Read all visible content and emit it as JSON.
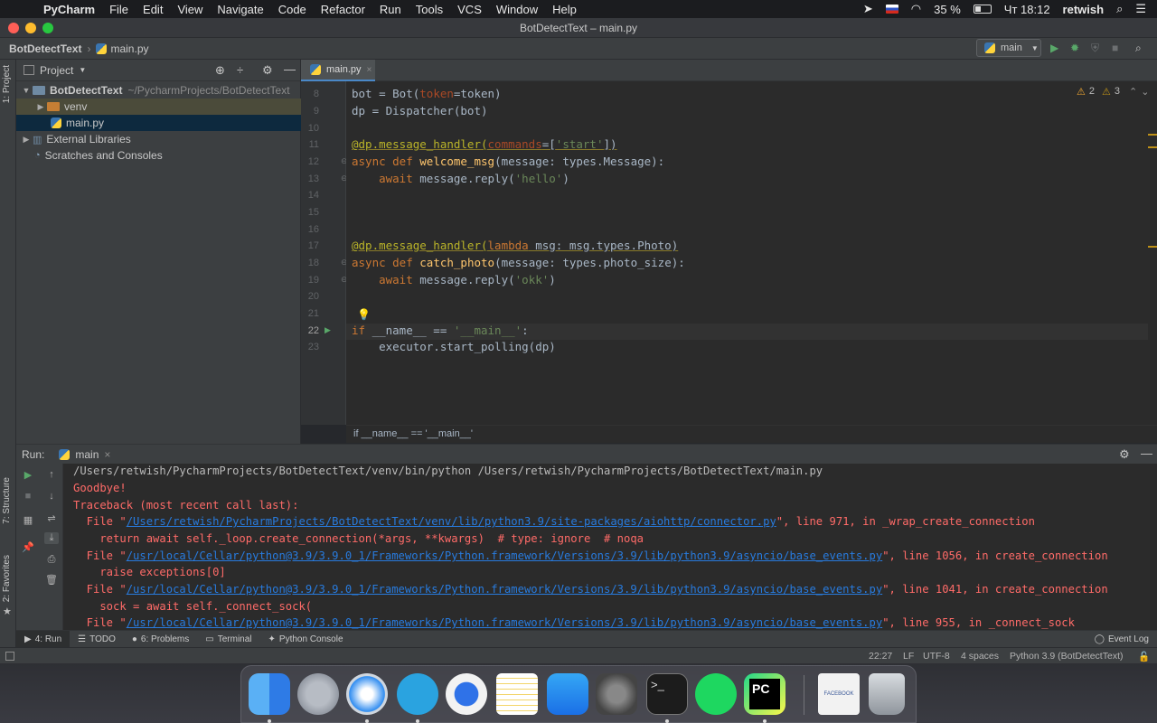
{
  "menubar": {
    "app": "PyCharm",
    "items": [
      "File",
      "Edit",
      "View",
      "Navigate",
      "Code",
      "Refactor",
      "Run",
      "Tools",
      "VCS",
      "Window",
      "Help"
    ],
    "battery": "35 %",
    "clock": "Чт 18:12",
    "user": "retwish"
  },
  "window": {
    "title": "BotDetectText – main.py"
  },
  "navbar": {
    "project": "BotDetectText",
    "file": "main.py",
    "run_config": "main"
  },
  "project_panel": {
    "title": "Project",
    "tree": [
      {
        "label": "BotDetectText",
        "path": "~/PycharmProjects/BotDetectText"
      },
      {
        "label": "venv"
      },
      {
        "label": "main.py"
      },
      {
        "label": "External Libraries"
      },
      {
        "label": "Scratches and Consoles"
      }
    ]
  },
  "left_strip": {
    "project_tab": "1: Project",
    "structure_tab": "7: Structure",
    "favorites_tab": "2: Favorites"
  },
  "editor": {
    "tab": "main.py",
    "warnings": "2",
    "weak_warnings": "3",
    "breadcrumb": "if __name__ == '__main__'",
    "line_numbers": [
      "8",
      "9",
      "10",
      "11",
      "12",
      "13",
      "14",
      "15",
      "16",
      "17",
      "18",
      "19",
      "20",
      "21",
      "22",
      "23"
    ],
    "lines": {
      "l8": [
        "bot = Bot(",
        "token",
        "=token)"
      ],
      "l9": "dp = Dispatcher(bot)",
      "l11": [
        "@dp.message_handler(",
        "commands",
        "=[",
        "'start'",
        "])"
      ],
      "l12": [
        "async def ",
        "welcome_msg",
        "(message: types.Message):"
      ],
      "l13": [
        "    ",
        "await",
        " message.reply(",
        "'hello'",
        ")"
      ],
      "l17": [
        "@dp.message_handler(",
        "lambda",
        " msg: msg.types.Photo)"
      ],
      "l18": [
        "async def ",
        "catch_photo",
        "(message: types.photo_size):"
      ],
      "l19": [
        "    ",
        "await",
        " message.reply(",
        "'okk'",
        ")"
      ],
      "l22": [
        "if ",
        "__name__ == ",
        "'__main__'",
        ":"
      ],
      "l23": "    executor.start_polling(dp)"
    }
  },
  "run_panel": {
    "label": "Run:",
    "tab": "main",
    "console": {
      "cmd": "/Users/retwish/PycharmProjects/BotDetectText/venv/bin/python /Users/retwish/PycharmProjects/BotDetectText/main.py",
      "goodbye": "Goodbye!",
      "traceback": "Traceback (most recent call last):",
      "f1_pre": "  File \"",
      "f1_path": "/Users/retwish/PycharmProjects/BotDetectText/venv/lib/python3.9/site-packages/aiohttp/connector.py",
      "f1_post": "\", line 971, in _wrap_create_connection",
      "c1": "    return await self._loop.create_connection(*args, **kwargs)  # type: ignore  # noqa",
      "f2_pre": "  File \"",
      "f2_path": "/usr/local/Cellar/python@3.9/3.9.0_1/Frameworks/Python.framework/Versions/3.9/lib/python3.9/asyncio/base_events.py",
      "f2_post": "\", line 1056, in create_connection",
      "c2": "    raise exceptions[0]",
      "f3_pre": "  File \"",
      "f3_path": "/usr/local/Cellar/python@3.9/3.9.0_1/Frameworks/Python.framework/Versions/3.9/lib/python3.9/asyncio/base_events.py",
      "f3_post": "\", line 1041, in create_connection",
      "c3": "    sock = await self._connect_sock(",
      "f4_pre": "  File \"",
      "f4_path": "/usr/local/Cellar/python@3.9/3.9.0_1/Frameworks/Python.framework/Versions/3.9/lib/python3.9/asyncio/base_events.py",
      "f4_post": "\", line 955, in _connect_sock"
    }
  },
  "bottom_tabs": {
    "run": "4: Run",
    "todo": "TODO",
    "problems": "6: Problems",
    "terminal": "Terminal",
    "python_console": "Python Console",
    "event_log": "Event Log"
  },
  "statusbar": {
    "position": "22:27",
    "line_sep": "LF",
    "encoding": "UTF-8",
    "indent": "4 spaces",
    "interpreter": "Python 3.9 (BotDetectText)"
  },
  "dock": {
    "facebook_label": "FACEBOOK",
    "pycharm_label": "PC"
  },
  "colors": {
    "accent": "#4a88c7",
    "error": "#ff6b68",
    "link": "#287bde",
    "keyword": "#cc7832"
  }
}
